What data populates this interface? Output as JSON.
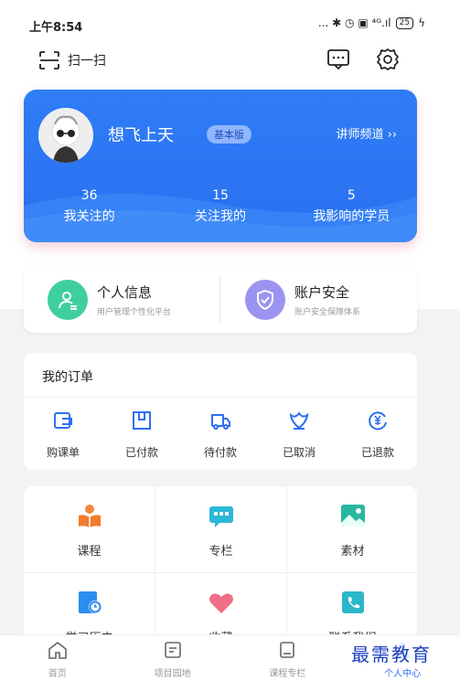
{
  "status_bar": {
    "time": "上午8:54",
    "icons": "... ✱ ◷ ▣ ⁴ᴳ.ıl",
    "battery": "25",
    "bolt": "ϟ"
  },
  "top_bar": {
    "scan_label": "扫一扫"
  },
  "profile": {
    "username": "想飞上天",
    "version": "基本版",
    "lecturer_link": "讲师频道 ››",
    "stats": [
      {
        "num": "36",
        "label": "我关注的"
      },
      {
        "num": "15",
        "label": "关注我的"
      },
      {
        "num": "5",
        "label": "我影响的学员"
      }
    ],
    "colors": {
      "card": "#2f7df6",
      "badge": "#8fb6ff"
    }
  },
  "info": {
    "personal": {
      "title": "个人信息",
      "sub": "用户管理个性化平台"
    },
    "security": {
      "title": "账户安全",
      "sub": "账户安全保障体系"
    }
  },
  "orders": {
    "title": "我的订单",
    "items": [
      {
        "label": "购课单",
        "icon": "cart-icon"
      },
      {
        "label": "已付款",
        "icon": "package-icon"
      },
      {
        "label": "待付款",
        "icon": "truck-icon"
      },
      {
        "label": "已取消",
        "icon": "cancel-icon"
      },
      {
        "label": "已退款",
        "icon": "yen-refund-icon"
      }
    ]
  },
  "grid": {
    "items": [
      {
        "label": "课程",
        "icon": "course-icon"
      },
      {
        "label": "专栏",
        "icon": "column-icon"
      },
      {
        "label": "素材",
        "icon": "material-icon"
      },
      {
        "label": "学习历史",
        "icon": "history-icon"
      },
      {
        "label": "收藏",
        "icon": "heart-icon"
      },
      {
        "label": "联系我们",
        "icon": "phone-icon"
      }
    ]
  },
  "tabs": [
    {
      "label": "首页",
      "icon": "home-icon"
    },
    {
      "label": "项目园地",
      "icon": "project-icon"
    },
    {
      "label": "课程专栏",
      "icon": "course-column-icon"
    },
    {
      "label": "个人中心",
      "icon": "person-icon"
    }
  ],
  "watermark": "最需教育"
}
